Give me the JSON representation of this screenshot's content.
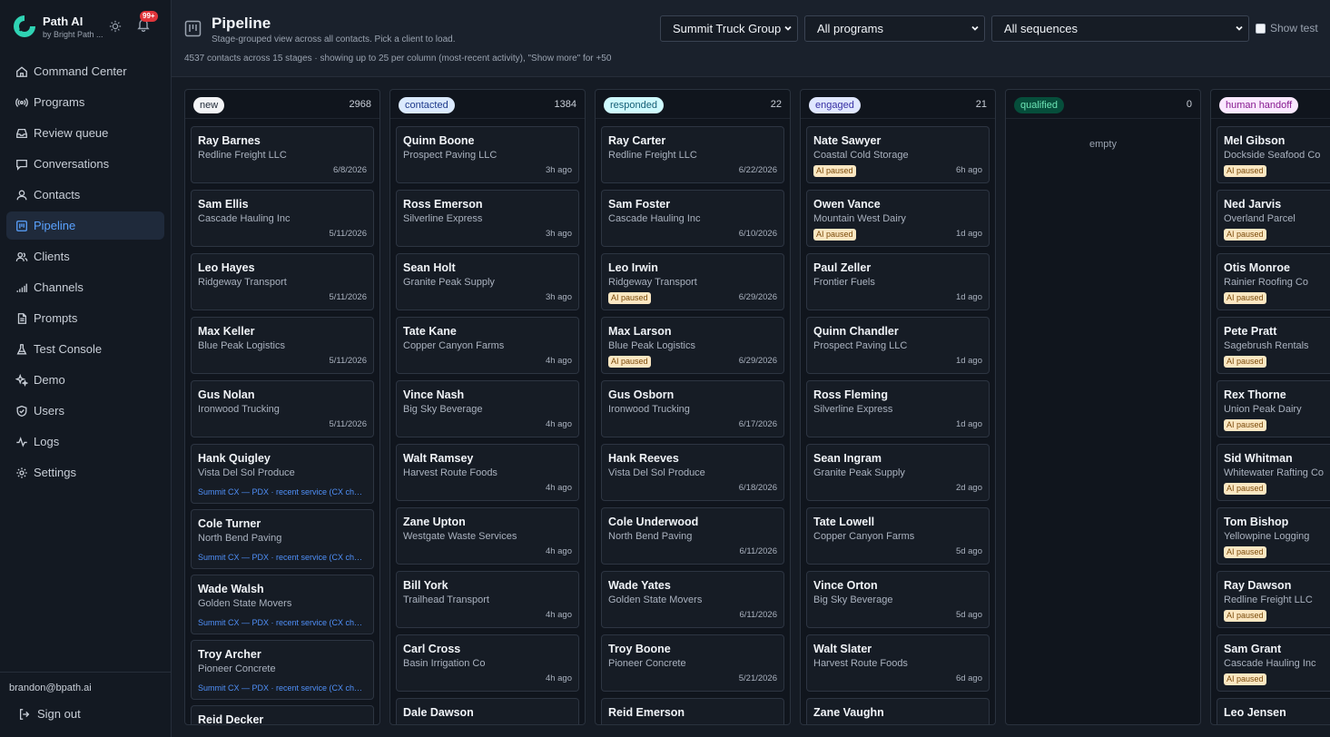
{
  "brand": {
    "name": "Path AI",
    "subtitle": "by Bright Path ...",
    "notif_count": "99+",
    "colors": {
      "accent": "#5aa2ff",
      "logo": "#2fd3b4"
    }
  },
  "nav": [
    {
      "id": "command-center",
      "label": "Command Center",
      "icon": "home-icon"
    },
    {
      "id": "programs",
      "label": "Programs",
      "icon": "broadcast-icon"
    },
    {
      "id": "review-queue",
      "label": "Review queue",
      "icon": "inbox-icon"
    },
    {
      "id": "conversations",
      "label": "Conversations",
      "icon": "chat-icon"
    },
    {
      "id": "contacts",
      "label": "Contacts",
      "icon": "user-icon"
    },
    {
      "id": "pipeline",
      "label": "Pipeline",
      "icon": "kanban-icon",
      "active": true
    },
    {
      "id": "clients",
      "label": "Clients",
      "icon": "users-icon"
    },
    {
      "id": "channels",
      "label": "Channels",
      "icon": "signal-icon"
    },
    {
      "id": "prompts",
      "label": "Prompts",
      "icon": "document-icon"
    },
    {
      "id": "test-console",
      "label": "Test Console",
      "icon": "flask-icon"
    },
    {
      "id": "demo",
      "label": "Demo",
      "icon": "sparkle-icon"
    },
    {
      "id": "users",
      "label": "Users",
      "icon": "shield-icon"
    },
    {
      "id": "logs",
      "label": "Logs",
      "icon": "activity-icon"
    },
    {
      "id": "settings",
      "label": "Settings",
      "icon": "gear-icon"
    }
  ],
  "user": {
    "email": "brandon@bpath.ai",
    "sign_out": "Sign out"
  },
  "header": {
    "title": "Pipeline",
    "subtitle": "Stage-grouped view across all contacts. Pick a client to load.",
    "note": "4537 contacts across 15 stages · showing up to 25 per column (most-recent activity), \"Show more\" for +50",
    "client_select": "Summit Truck Group",
    "program_select": "All programs",
    "sequence_select": "All sequences",
    "show_test": "Show test"
  },
  "columns": [
    {
      "stage": "new",
      "count": "2968",
      "pill_bg": "#f3f4f6",
      "pill_fg": "#1f2937",
      "cards": [
        {
          "name": "Ray Barnes",
          "company": "Redline Freight LLC",
          "time": "6/8/2026"
        },
        {
          "name": "Sam Ellis",
          "company": "Cascade Hauling Inc",
          "time": "5/11/2026"
        },
        {
          "name": "Leo Hayes",
          "company": "Ridgeway Transport",
          "time": "5/11/2026"
        },
        {
          "name": "Max Keller",
          "company": "Blue Peak Logistics",
          "time": "5/11/2026"
        },
        {
          "name": "Gus Nolan",
          "company": "Ironwood Trucking",
          "time": "5/11/2026"
        },
        {
          "name": "Hank Quigley",
          "company": "Vista Del Sol Produce",
          "seq": "Summit CX — PDX · recent service (CX check-in)"
        },
        {
          "name": "Cole Turner",
          "company": "North Bend Paving",
          "seq": "Summit CX — PDX · recent service (CX check-in)"
        },
        {
          "name": "Wade Walsh",
          "company": "Golden State Movers",
          "seq": "Summit CX — PDX · recent service (CX check-in)"
        },
        {
          "name": "Troy Archer",
          "company": "Pioneer Concrete",
          "seq": "Summit CX — PDX · recent service (CX check-in)"
        },
        {
          "name": "Reid Decker",
          "company": ""
        }
      ]
    },
    {
      "stage": "contacted",
      "count": "1384",
      "pill_bg": "#dbeafe",
      "pill_fg": "#1e3a8a",
      "cards": [
        {
          "name": "Quinn Boone",
          "company": "Prospect Paving LLC",
          "time": "3h ago"
        },
        {
          "name": "Ross Emerson",
          "company": "Silverline Express",
          "time": "3h ago"
        },
        {
          "name": "Sean Holt",
          "company": "Granite Peak Supply",
          "time": "3h ago"
        },
        {
          "name": "Tate Kane",
          "company": "Copper Canyon Farms",
          "time": "4h ago"
        },
        {
          "name": "Vince Nash",
          "company": "Big Sky Beverage",
          "time": "4h ago"
        },
        {
          "name": "Walt Ramsey",
          "company": "Harvest Route Foods",
          "time": "4h ago"
        },
        {
          "name": "Zane Upton",
          "company": "Westgate Waste Services",
          "time": "4h ago"
        },
        {
          "name": "Bill York",
          "company": "Trailhead Transport",
          "time": "4h ago"
        },
        {
          "name": "Carl Cross",
          "company": "Basin Irrigation Co",
          "time": "4h ago"
        },
        {
          "name": "Dale Dawson",
          "company": ""
        }
      ]
    },
    {
      "stage": "responded",
      "count": "22",
      "pill_bg": "#cffafe",
      "pill_fg": "#155e75",
      "cards": [
        {
          "name": "Ray Carter",
          "company": "Redline Freight LLC",
          "time": "6/22/2026"
        },
        {
          "name": "Sam Foster",
          "company": "Cascade Hauling Inc",
          "time": "6/10/2026"
        },
        {
          "name": "Leo Irwin",
          "company": "Ridgeway Transport",
          "paused": "AI paused",
          "time": "6/29/2026"
        },
        {
          "name": "Max Larson",
          "company": "Blue Peak Logistics",
          "paused": "AI paused",
          "time": "6/29/2026"
        },
        {
          "name": "Gus Osborn",
          "company": "Ironwood Trucking",
          "time": "6/17/2026"
        },
        {
          "name": "Hank Reeves",
          "company": "Vista Del Sol Produce",
          "time": "6/18/2026"
        },
        {
          "name": "Cole Underwood",
          "company": "North Bend Paving",
          "time": "6/11/2026"
        },
        {
          "name": "Wade Yates",
          "company": "Golden State Movers",
          "time": "6/11/2026"
        },
        {
          "name": "Troy Boone",
          "company": "Pioneer Concrete",
          "time": "5/21/2026"
        },
        {
          "name": "Reid Emerson",
          "company": ""
        }
      ]
    },
    {
      "stage": "engaged",
      "count": "21",
      "pill_bg": "#e0e7ff",
      "pill_fg": "#3730a3",
      "cards": [
        {
          "name": "Nate Sawyer",
          "company": "Coastal Cold Storage",
          "paused": "AI paused",
          "time": "6h ago"
        },
        {
          "name": "Owen Vance",
          "company": "Mountain West Dairy",
          "paused": "AI paused",
          "time": "1d ago"
        },
        {
          "name": "Paul Zeller",
          "company": "Frontier Fuels",
          "time": "1d ago"
        },
        {
          "name": "Quinn Chandler",
          "company": "Prospect Paving LLC",
          "time": "1d ago"
        },
        {
          "name": "Ross Fleming",
          "company": "Silverline Express",
          "time": "1d ago"
        },
        {
          "name": "Sean Ingram",
          "company": "Granite Peak Supply",
          "time": "2d ago"
        },
        {
          "name": "Tate Lowell",
          "company": "Copper Canyon Farms",
          "time": "5d ago"
        },
        {
          "name": "Vince Orton",
          "company": "Big Sky Beverage",
          "time": "5d ago"
        },
        {
          "name": "Walt Slater",
          "company": "Harvest Route Foods",
          "time": "6d ago"
        },
        {
          "name": "Zane Vaughn",
          "company": ""
        }
      ]
    },
    {
      "stage": "qualified",
      "count": "0",
      "pill_bg": "#064e3b",
      "pill_fg": "#6ee7b7",
      "empty_text": "empty",
      "cards": []
    },
    {
      "stage": "human handoff",
      "count": "",
      "pill_bg": "#fae8ff",
      "pill_fg": "#86198f",
      "cards": [
        {
          "name": "Mel Gibson",
          "company": "Dockside Seafood Co",
          "paused": "AI paused"
        },
        {
          "name": "Ned Jarvis",
          "company": "Overland Parcel",
          "paused": "AI paused"
        },
        {
          "name": "Otis Monroe",
          "company": "Rainier Roofing Co",
          "paused": "AI paused"
        },
        {
          "name": "Pete Pratt",
          "company": "Sagebrush Rentals",
          "paused": "AI paused"
        },
        {
          "name": "Rex Thorne",
          "company": "Union Peak Dairy",
          "paused": "AI paused"
        },
        {
          "name": "Sid Whitman",
          "company": "Whitewater Rafting Co",
          "paused": "AI paused"
        },
        {
          "name": "Tom Bishop",
          "company": "Yellowpine Logging",
          "paused": "AI paused"
        },
        {
          "name": "Ray Dawson",
          "company": "Redline Freight LLC",
          "paused": "AI paused"
        },
        {
          "name": "Sam Grant",
          "company": "Cascade Hauling Inc",
          "paused": "AI paused"
        },
        {
          "name": "Leo Jensen",
          "company": ""
        }
      ]
    }
  ]
}
